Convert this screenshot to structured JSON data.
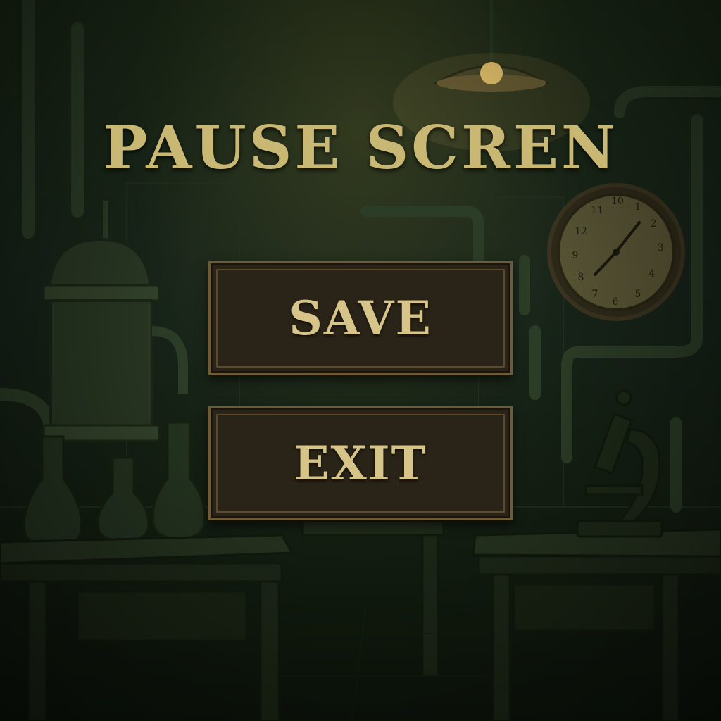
{
  "screen": {
    "title": "PAUSE SCREN"
  },
  "menu": {
    "save_label": "SAVE",
    "exit_label": "EXIT"
  },
  "clock": {
    "numerals": [
      "10",
      "11",
      "1",
      "2",
      "3",
      "4",
      "5",
      "6",
      "7",
      "8",
      "9",
      "12"
    ]
  },
  "colors": {
    "title_gold": "#c9b774",
    "button_fill": "#2a2418",
    "button_border": "#6e5a35",
    "label_gold": "#d6c489",
    "background_green": "#18251a"
  }
}
